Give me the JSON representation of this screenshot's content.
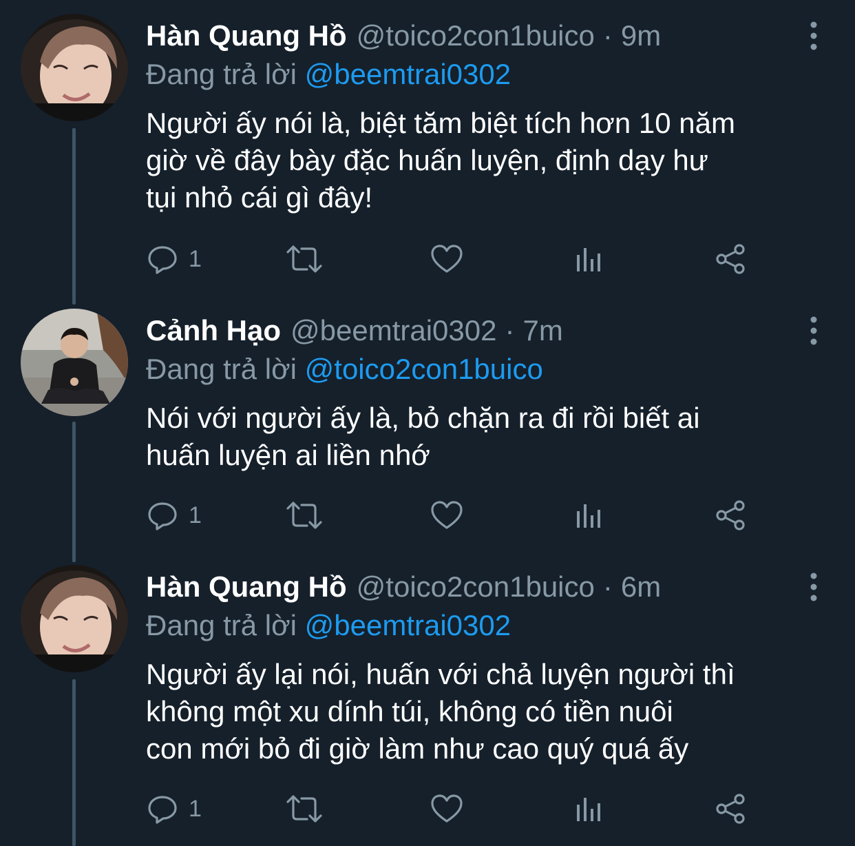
{
  "colors": {
    "background": "#15202b",
    "text_primary": "#ffffff",
    "text_secondary": "#8899a6",
    "link": "#1d9bf0",
    "thread_line": "#3d5466"
  },
  "tweets": [
    {
      "name": "Hàn Quang Hồ",
      "handle": "@toico2con1buico",
      "separator": "·",
      "time": "9m",
      "reply_prefix": "Đang trả lời",
      "reply_handle": "@beemtrai0302",
      "body": "Người ấy nói là, biệt tăm biệt tích hơn 10 năm\ngiờ về đây bày đặc huấn luyện, định dạy hư\ntụi nhỏ cái gì đây!",
      "reply_count": "1",
      "icons": [
        "reply-icon",
        "retweet-icon",
        "like-icon",
        "analytics-icon",
        "share-icon",
        "more-icon"
      ]
    },
    {
      "name": "Cảnh Hạo",
      "handle": "@beemtrai0302",
      "separator": "·",
      "time": "7m",
      "reply_prefix": "Đang trả lời",
      "reply_handle": "@toico2con1buico",
      "body": "Nói với người ấy là, bỏ chặn ra đi rồi biết ai\nhuấn luyện ai liền nhớ",
      "reply_count": "1",
      "icons": [
        "reply-icon",
        "retweet-icon",
        "like-icon",
        "analytics-icon",
        "share-icon",
        "more-icon"
      ]
    },
    {
      "name": "Hàn Quang Hồ",
      "handle": "@toico2con1buico",
      "separator": "·",
      "time": "6m",
      "reply_prefix": "Đang trả lời",
      "reply_handle": "@beemtrai0302",
      "body": "Người ấy lại nói, huấn với chả luyện người thì\nkhông một xu dính túi, không có tiền nuôi\ncon mới bỏ đi giờ làm như cao quý quá ấy",
      "reply_count": "1",
      "icons": [
        "reply-icon",
        "retweet-icon",
        "like-icon",
        "analytics-icon",
        "share-icon",
        "more-icon"
      ]
    }
  ]
}
